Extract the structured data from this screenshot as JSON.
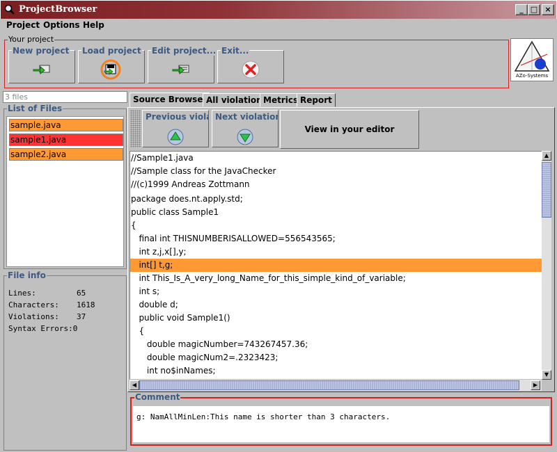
{
  "window": {
    "title": "ProjectBrowser",
    "minimize": "_",
    "maximize": "□",
    "close": "×"
  },
  "menu": [
    "Project",
    "Options",
    "Help"
  ],
  "project_group": {
    "legend": "Your project",
    "buttons": [
      "New project",
      "Load project",
      "Edit project...",
      "Exit..."
    ]
  },
  "logo": {
    "text": "AZo-Systems"
  },
  "files": {
    "count_text": "3 files",
    "list_legend": "List of Files",
    "items": [
      {
        "name": "sample.java",
        "color": "#ff9933"
      },
      {
        "name": "sample1.java",
        "color": "#ff3333"
      },
      {
        "name": "sample2.java",
        "color": "#ff9933"
      }
    ]
  },
  "file_info": {
    "legend": "File info",
    "rows": [
      {
        "key": "Lines:",
        "value": "65"
      },
      {
        "key": "Characters:",
        "value": "1618"
      },
      {
        "key": "Violations:",
        "value": "37"
      },
      {
        "key": "Syntax Errors:",
        "value": "0"
      }
    ]
  },
  "tabs": [
    "Source Browser",
    "All violations",
    "Metrics",
    "Report"
  ],
  "active_tab": "Source Browser",
  "nav": {
    "previous": "Previous violation",
    "next": "Next violation",
    "editor": "View in your editor"
  },
  "code_lines": [
    "//Sample1.java",
    "//Sample class for the JavaChecker",
    "//(c)1999 Andreas Zottmann",
    "package does.nt.apply.std;",
    "public class Sample1",
    "{",
    "   final int THISNUMBERISALLOWED=556543565;",
    "   int z,j,x[],y;",
    "   int[] t,g;",
    "   int This_Is_A_very_long_Name_for_this_simple_kind_of_variable;",
    "   int s;",
    "   double d;",
    "   public void Sample1()",
    "   {",
    "      double magicNumber=743267457.36;",
    "      double magicNum2=.2323423;",
    "      int no$inNames;"
  ],
  "highlighted_line": 8,
  "highlight_color": "#ff9933",
  "comment": {
    "legend": "Comment",
    "text": "g: NamAllMinLen:This name is shorter than 3 characters."
  }
}
